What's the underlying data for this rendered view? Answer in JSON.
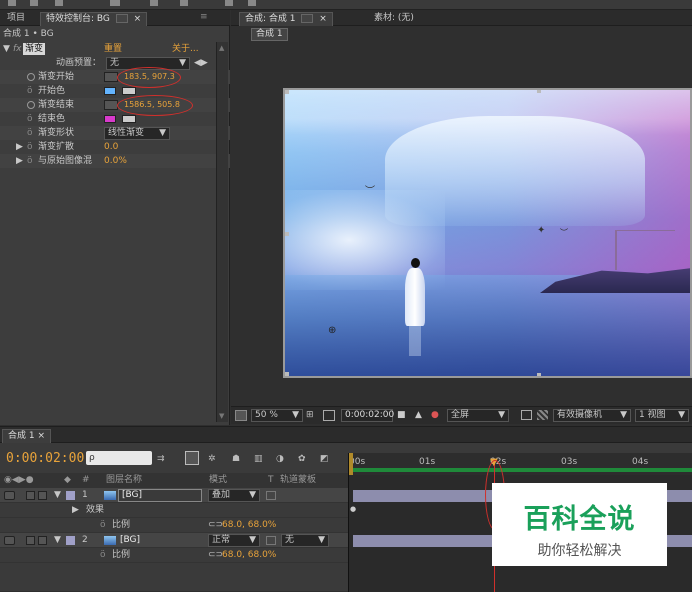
{
  "menu_icons": [
    "arrow-icon",
    "hand-icon",
    "zoom-icon",
    "rotate-icon",
    "camera-icon",
    "pen-icon",
    "text-icon",
    "brush-icon"
  ],
  "effect_panel": {
    "tabs": [
      "项目",
      "特效控制台: BG"
    ],
    "path": "合成 1 • BG",
    "effect": {
      "fx": "fx",
      "name": "渐变",
      "reset": "重置",
      "about": "关于..."
    },
    "anim_preset_label": "动画预置：",
    "anim_preset_value": "无",
    "props": [
      {
        "name": "渐变开始",
        "value": "183.5, 907.3"
      },
      {
        "name": "开始色",
        "color": "#63b4ff"
      },
      {
        "name": "渐变结束",
        "value": "1586.5, 505.8"
      },
      {
        "name": "结束色",
        "color": "#d83acb"
      },
      {
        "name": "渐变形状",
        "value": "线性渐变"
      },
      {
        "name": "渐变扩散",
        "value": "0.0"
      },
      {
        "name": "与原始图像混",
        "value": "0.0%"
      }
    ]
  },
  "viewer": {
    "tabs": [
      "合成: 合成 1",
      "素材: (无)"
    ],
    "breadcrumb": "合成 1",
    "bottom": {
      "zoom": "50 %",
      "time": "0:00:02:00",
      "res": "全屏",
      "camera": "有效摄像机",
      "views": "1 视图"
    }
  },
  "timeline": {
    "tab": "合成 1",
    "time": "0:00:02:00",
    "search_placeholder": "ρ",
    "columns": [
      "#",
      "图层名称",
      "模式",
      "T",
      "轨道蒙板"
    ],
    "ruler": [
      "00s",
      "01s",
      "02s",
      "03s",
      "04s"
    ],
    "layers": [
      {
        "num": "1",
        "name": "[BG]",
        "mode": "叠加"
      },
      {
        "label": "效果"
      },
      {
        "label": "比例",
        "value": "68.0, 68.0%"
      },
      {
        "num": "2",
        "name": "[BG]",
        "mode": "正常",
        "matte": "无"
      },
      {
        "label": "比例",
        "value": "68.0, 68.0%"
      }
    ]
  },
  "watermark": {
    "title": "百科全说",
    "subtitle": "助你轻松解决"
  },
  "colors": {
    "accent": "#e8a33a",
    "annotation": "#d0302c",
    "layer_bar": "#8d8dad"
  }
}
